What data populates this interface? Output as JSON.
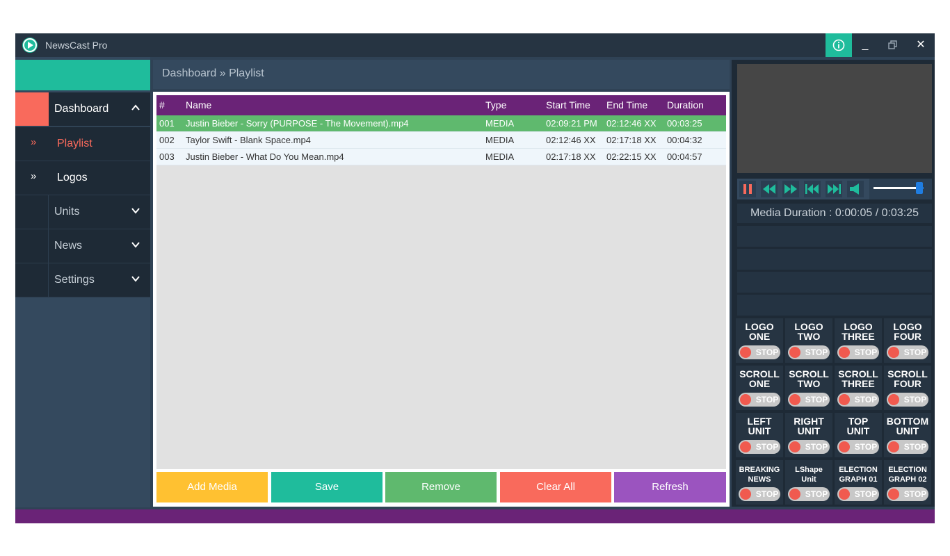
{
  "app": {
    "title": "NewsCast Pro"
  },
  "titlebar": {
    "info_icon": "info-icon",
    "min_label": "_",
    "max_icon": "restore-icon",
    "close_label": "✕"
  },
  "sidebar": {
    "items": [
      {
        "label": "Dashboard",
        "expanded": true,
        "active": true
      },
      {
        "label": "Playlist",
        "mark": "»",
        "active": true
      },
      {
        "label": "Logos",
        "mark": "»"
      },
      {
        "label": "Units",
        "expanded": false
      },
      {
        "label": "News",
        "expanded": false
      },
      {
        "label": "Settings",
        "expanded": false
      }
    ]
  },
  "breadcrumb": "Dashboard » Playlist",
  "playlist": {
    "columns": [
      "#",
      "Name",
      "Type",
      "Start Time",
      "End Time",
      "Duration"
    ],
    "rows": [
      {
        "num": "001",
        "name": "Justin Bieber - Sorry (PURPOSE - The Movement).mp4",
        "type": "MEDIA",
        "start": "02:09:21 PM",
        "end": "02:12:46 XX",
        "duration": "00:03:25",
        "active": true
      },
      {
        "num": "002",
        "name": "Taylor Swift - Blank Space.mp4",
        "type": "MEDIA",
        "start": "02:12:46 XX",
        "end": "02:17:18 XX",
        "duration": "00:04:32"
      },
      {
        "num": "003",
        "name": "Justin Bieber - What Do You Mean.mp4",
        "type": "MEDIA",
        "start": "02:17:18 XX",
        "end": "02:22:15 XX",
        "duration": "00:04:57"
      }
    ]
  },
  "actions": {
    "add": "Add Media",
    "save": "Save",
    "remove": "Remove",
    "clear": "Clear All",
    "refresh": "Refresh"
  },
  "player": {
    "duration_text": "Media Duration : 0:00:05 / 0:03:25",
    "volume": 0.88
  },
  "colors": {
    "accent": "#1fbc9c",
    "coral": "#f96a5c",
    "purple": "#6a2377",
    "add": "#ffc131",
    "remove": "#5fb96e",
    "refresh": "#9b54bf"
  },
  "controls": [
    {
      "line1": "LOGO",
      "line2": "ONE",
      "state": "STOP"
    },
    {
      "line1": "LOGO",
      "line2": "TWO",
      "state": "STOP"
    },
    {
      "line1": "LOGO",
      "line2": "THREE",
      "state": "STOP"
    },
    {
      "line1": "LOGO",
      "line2": "FOUR",
      "state": "STOP"
    },
    {
      "line1": "SCROLL",
      "line2": "ONE",
      "state": "STOP"
    },
    {
      "line1": "SCROLL",
      "line2": "TWO",
      "state": "STOP"
    },
    {
      "line1": "SCROLL",
      "line2": "THREE",
      "state": "STOP"
    },
    {
      "line1": "SCROLL",
      "line2": "FOUR",
      "state": "STOP"
    },
    {
      "line1": "LEFT",
      "line2": "UNIT",
      "state": "STOP"
    },
    {
      "line1": "RIGHT",
      "line2": "UNIT",
      "state": "STOP"
    },
    {
      "line1": "TOP",
      "line2": "UNIT",
      "state": "STOP"
    },
    {
      "line1": "BOTTOM",
      "line2": "UNIT",
      "state": "STOP"
    },
    {
      "line1": "BREAKING",
      "line2": "NEWS",
      "state": "STOP"
    },
    {
      "line1": "LShape",
      "line2": "Unit",
      "state": "STOP"
    },
    {
      "line1": "ELECTION",
      "line2": "GRAPH 01",
      "state": "STOP"
    },
    {
      "line1": "ELECTION",
      "line2": "GRAPH 02",
      "state": "STOP"
    }
  ]
}
